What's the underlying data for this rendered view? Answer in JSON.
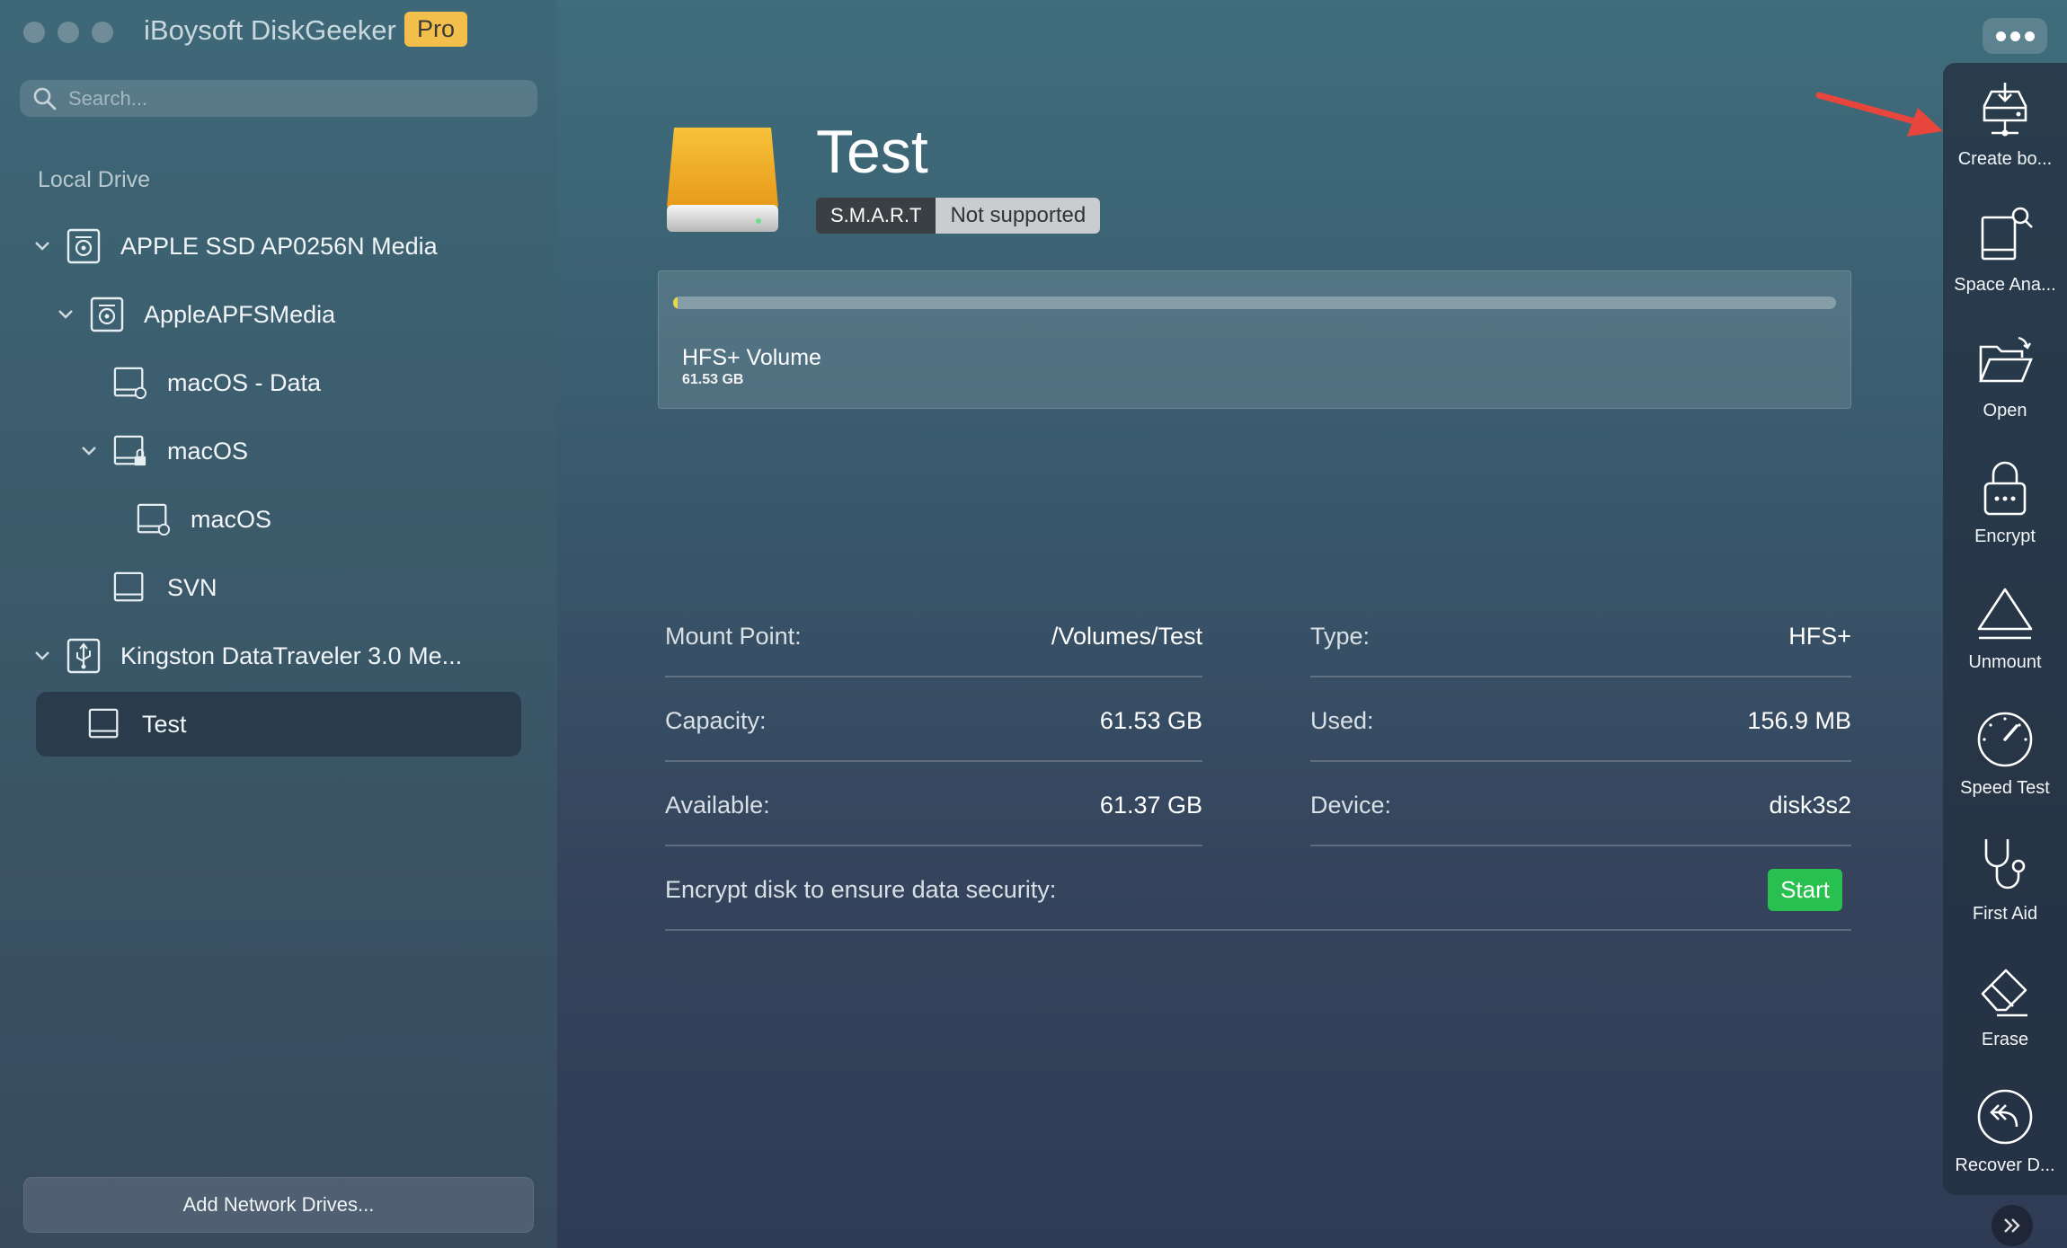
{
  "app": {
    "title": "iBoysoft DiskGeeker",
    "badge": "Pro"
  },
  "search": {
    "placeholder": "Search..."
  },
  "sidebar": {
    "section_title": "Local Drive",
    "items": [
      {
        "label": "APPLE SSD AP0256N Media",
        "icon": "disk-icon",
        "expanded": true
      },
      {
        "label": "AppleAPFSMedia",
        "icon": "disk-icon",
        "expanded": true
      },
      {
        "label": "macOS - Data",
        "icon": "volume-icon"
      },
      {
        "label": "macOS",
        "icon": "lock-volume-icon",
        "expanded": true
      },
      {
        "label": "macOS",
        "icon": "volume-icon"
      },
      {
        "label": "SVN",
        "icon": "volume-icon"
      },
      {
        "label": "Kingston DataTraveler 3.0 Me...",
        "icon": "usb-icon",
        "expanded": true
      },
      {
        "label": "Test",
        "icon": "volume-icon",
        "selected": true
      }
    ],
    "add_network": "Add Network Drives..."
  },
  "volume": {
    "name": "Test",
    "smart_label": "S.M.A.R.T",
    "smart_status": "Not supported",
    "type_label": "HFS+ Volume",
    "size_label": "61.53 GB",
    "used_fraction": 0.0025
  },
  "info": {
    "mount_point": {
      "label": "Mount Point:",
      "value": "/Volumes/Test"
    },
    "type": {
      "label": "Type:",
      "value": "HFS+"
    },
    "capacity": {
      "label": "Capacity:",
      "value": "61.53 GB"
    },
    "used": {
      "label": "Used:",
      "value": "156.9 MB"
    },
    "available": {
      "label": "Available:",
      "value": "61.37 GB"
    },
    "device": {
      "label": "Device:",
      "value": "disk3s2"
    },
    "encrypt_prompt": "Encrypt disk to ensure data security:",
    "start_label": "Start"
  },
  "toolbar": {
    "items": [
      {
        "label": "Create bo...",
        "icon": "create-boot-disk-icon"
      },
      {
        "label": "Space Ana...",
        "icon": "space-analyzer-icon"
      },
      {
        "label": "Open",
        "icon": "folder-open-icon"
      },
      {
        "label": "Encrypt",
        "icon": "lock-icon"
      },
      {
        "label": "Unmount",
        "icon": "eject-icon"
      },
      {
        "label": "Speed Test",
        "icon": "speedometer-icon"
      },
      {
        "label": "First Aid",
        "icon": "stethoscope-icon"
      },
      {
        "label": "Erase",
        "icon": "eraser-icon"
      },
      {
        "label": "Recover D...",
        "icon": "recover-icon"
      }
    ]
  },
  "colors": {
    "accent_badge": "#f2c04a",
    "start_button": "#28c04e",
    "annotation_arrow": "#e8463c"
  }
}
